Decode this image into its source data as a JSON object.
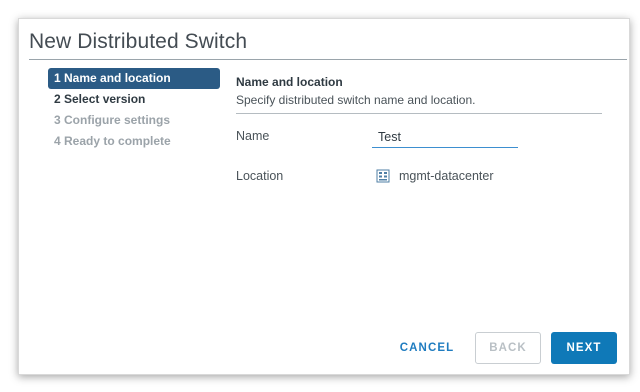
{
  "dialog": {
    "title": "New Distributed Switch"
  },
  "steps": [
    {
      "label": "1 Name and location",
      "state": "active"
    },
    {
      "label": "2 Select version",
      "state": "normal"
    },
    {
      "label": "3 Configure settings",
      "state": "disabled"
    },
    {
      "label": "4 Ready to complete",
      "state": "disabled"
    }
  ],
  "section": {
    "title": "Name and location",
    "subtitle": "Specify distributed switch name and location."
  },
  "form": {
    "name_label": "Name",
    "name_value": "Test",
    "location_label": "Location",
    "location_value": "mgmt-datacenter",
    "location_icon": "datacenter-icon"
  },
  "buttons": {
    "cancel": "CANCEL",
    "back": "BACK",
    "next": "NEXT"
  },
  "colors": {
    "active_step": "#2b5b85",
    "primary_button": "#0f79b8",
    "input_underline": "#3d8fd0",
    "link_button": "#1f7cc0"
  }
}
